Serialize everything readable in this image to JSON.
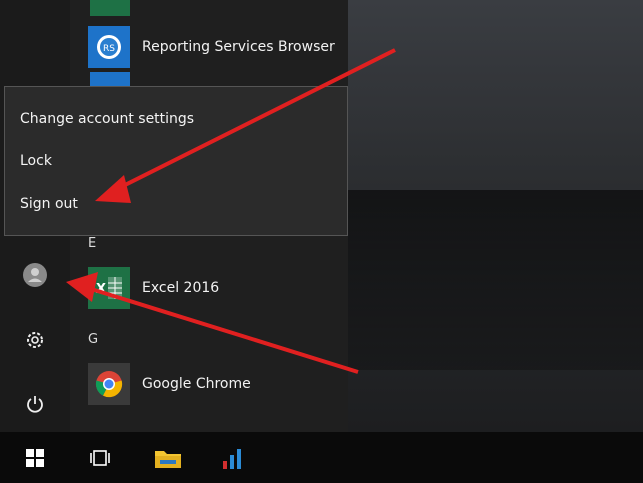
{
  "start_menu": {
    "apps": [
      {
        "label": "Reporting Services Browser",
        "icon": "reporting-services-icon"
      },
      {
        "label": "Excel 2016",
        "icon": "excel-icon"
      },
      {
        "label": "Google Chrome",
        "icon": "chrome-icon"
      }
    ],
    "section_letters": [
      "E",
      "G"
    ],
    "rail": {
      "user_icon": "user-avatar-icon",
      "settings_icon": "gear-icon",
      "power_icon": "power-icon"
    }
  },
  "account_menu": {
    "items": [
      "Change account settings",
      "Lock",
      "Sign out"
    ]
  },
  "taskbar": {
    "icons": [
      "windows-start-icon",
      "task-view-icon",
      "file-explorer-icon",
      "power-bi-icon"
    ]
  },
  "annotations": {
    "arrow_color": "#e02020"
  },
  "colors": {
    "excel_green": "#1e7145",
    "reporting_blue": "#1e73c9",
    "folder_yellow": "#f3c531",
    "powerbi_blue": "#2b8bd6"
  }
}
